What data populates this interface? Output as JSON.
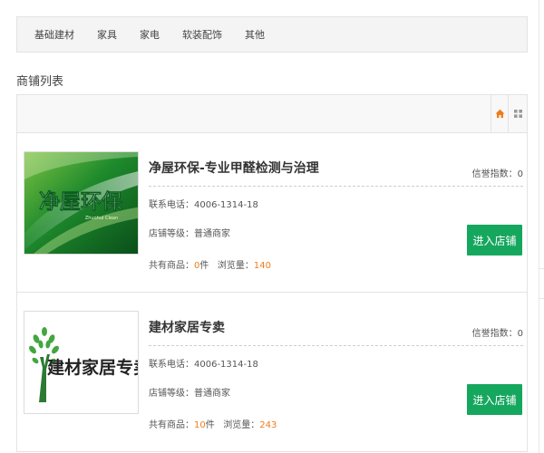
{
  "nav": {
    "items": [
      {
        "label": "基础建材"
      },
      {
        "label": "家具"
      },
      {
        "label": "家电"
      },
      {
        "label": "软装配饰"
      },
      {
        "label": "其他"
      }
    ]
  },
  "section": {
    "title": "商铺列表"
  },
  "toolbar": {
    "home_icon": "home-icon",
    "grid_icon": "grid-view-icon",
    "home_color": "#f07c1b",
    "grid_color": "#9a9a9a"
  },
  "colors": {
    "accent_button": "#16a75e",
    "highlight_number": "#f07c1b"
  },
  "shops": [
    {
      "name": "净屋环保-专业甲醛检测与治理",
      "logo_icon": "jingwu-huanbao-logo",
      "logo_text": "净屋环保",
      "logo_subtext": "Zhuohui Clean",
      "rating_label": "信誉指数：",
      "rating_value": "0",
      "phone_label": "联系电话：",
      "phone_value": "4006-1314-18",
      "level_label": "店铺等级：",
      "level_value": "普通商家",
      "goods_label": "共有商品：",
      "goods_value": "0",
      "goods_unit": "件",
      "views_label": "浏览量：",
      "views_value": "140",
      "enter_label": "进入店铺"
    },
    {
      "name": "建材家居专卖",
      "logo_icon": "tree-logo",
      "logo_text": "建材家居专卖",
      "rating_label": "信誉指数：",
      "rating_value": "0",
      "phone_label": "联系电话：",
      "phone_value": "4006-1314-18",
      "level_label": "店铺等级：",
      "level_value": "普通商家",
      "goods_label": "共有商品：",
      "goods_value": "10",
      "goods_unit": "件",
      "views_label": "浏览量：",
      "views_value": "243",
      "enter_label": "进入店铺"
    }
  ]
}
